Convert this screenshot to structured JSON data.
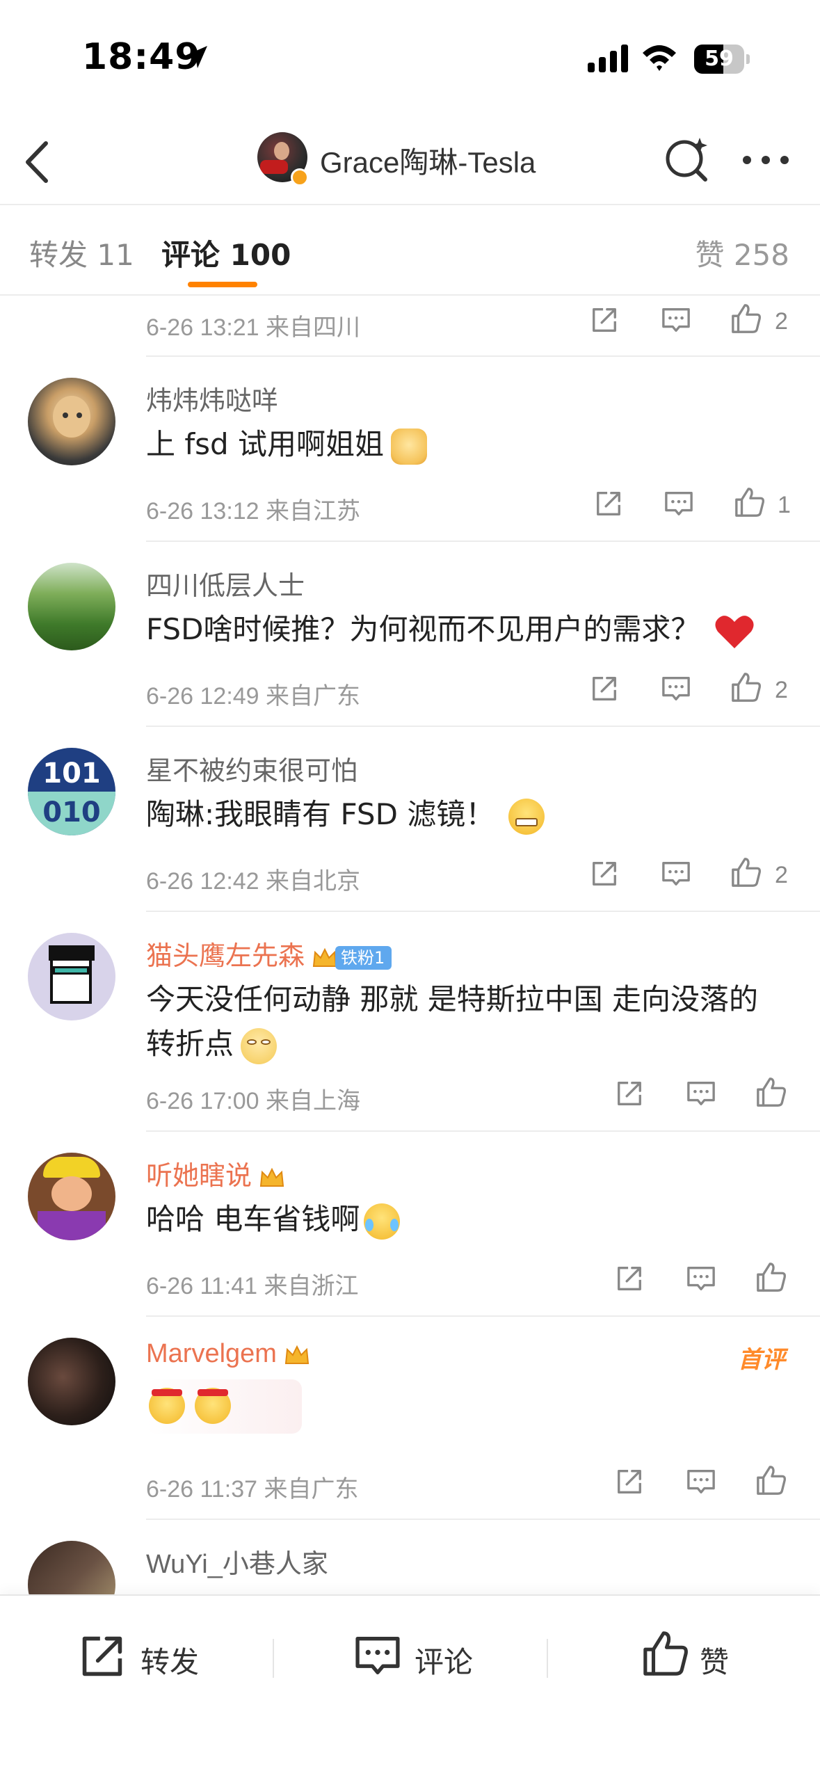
{
  "status_bar": {
    "time": "18:49",
    "battery": "59",
    "battery_level": 0.59
  },
  "header": {
    "title": "Grace陶琳-Tesla"
  },
  "tabs": {
    "repost": "转发 11",
    "comment": "评论 100",
    "like": "赞 258"
  },
  "comments": [
    {
      "name": "",
      "text": "",
      "meta": "6-26 13:21 来自四川",
      "likes": "2"
    },
    {
      "name": "炜炜炜哒咩",
      "text": "上 fsd 试用啊姐姐",
      "meta": "6-26 13:12 来自江苏",
      "likes": "1"
    },
    {
      "name": "四川低层人士",
      "text": "FSD啥时候推？为何视而不见用户的需求？",
      "meta": "6-26 12:49 来自广东",
      "likes": "2"
    },
    {
      "name": "星不被约束很可怕",
      "text": "陶琳:我眼睛有 FSD 滤镜！",
      "meta": "6-26 12:42 来自北京",
      "likes": "2",
      "avatar_top": "101",
      "avatar_bottom": "010"
    },
    {
      "name": "猫头鹰左先森",
      "badge": "铁粉1",
      "text": "今天没任何动静 那就 是特斯拉中国 走向没落的转折点",
      "meta": "6-26 17:00 来自上海",
      "likes": ""
    },
    {
      "name": "听她瞎说",
      "text": "哈哈 电车省钱啊",
      "meta": "6-26 11:41 来自浙江",
      "likes": ""
    },
    {
      "name": "Marvelgem",
      "tag": "首评",
      "text": "",
      "meta": "6-26 11:37 来自广东",
      "likes": ""
    },
    {
      "name": "WuYi_小巷人家",
      "text": "",
      "meta": "",
      "likes": ""
    }
  ],
  "bottom_bar": {
    "repost": "转发",
    "comment": "评论",
    "like": "赞"
  },
  "colors": {
    "accent": "#ff8200",
    "vip_name": "#eb7350",
    "fan_badge": "#5fa8ee"
  },
  "icons": [
    "location-arrow-icon",
    "signal-icon",
    "wifi-icon",
    "back-icon",
    "search-icon",
    "more-icon",
    "share-icon",
    "comment-icon",
    "like-icon"
  ]
}
